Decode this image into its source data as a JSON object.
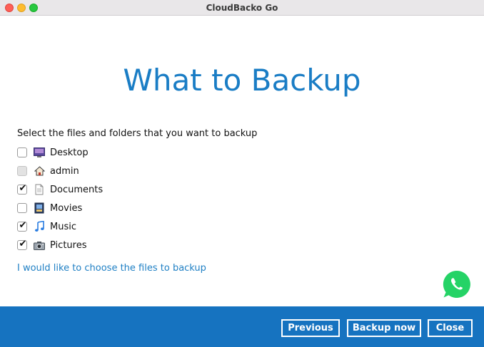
{
  "window": {
    "title": "CloudBacko Go"
  },
  "heading": "What to Backup",
  "instruction": "Select the files and folders that you want to backup",
  "items": [
    {
      "label": "Desktop",
      "checked": false,
      "disabled": false,
      "icon": "desktop-icon"
    },
    {
      "label": "admin",
      "checked": false,
      "disabled": true,
      "icon": "home-icon"
    },
    {
      "label": "Documents",
      "checked": true,
      "disabled": false,
      "icon": "documents-icon"
    },
    {
      "label": "Movies",
      "checked": false,
      "disabled": false,
      "icon": "movies-icon"
    },
    {
      "label": "Music",
      "checked": true,
      "disabled": false,
      "icon": "music-note-icon"
    },
    {
      "label": "Pictures",
      "checked": true,
      "disabled": false,
      "icon": "camera-icon"
    }
  ],
  "choose_files_link": "I would like to choose the files to backup",
  "footer": {
    "previous_label": "Previous",
    "backup_now_label": "Backup now",
    "close_label": "Close"
  },
  "colors": {
    "accent": "#1a7dc5",
    "footer": "#1673c0",
    "whatsapp": "#25d366"
  }
}
